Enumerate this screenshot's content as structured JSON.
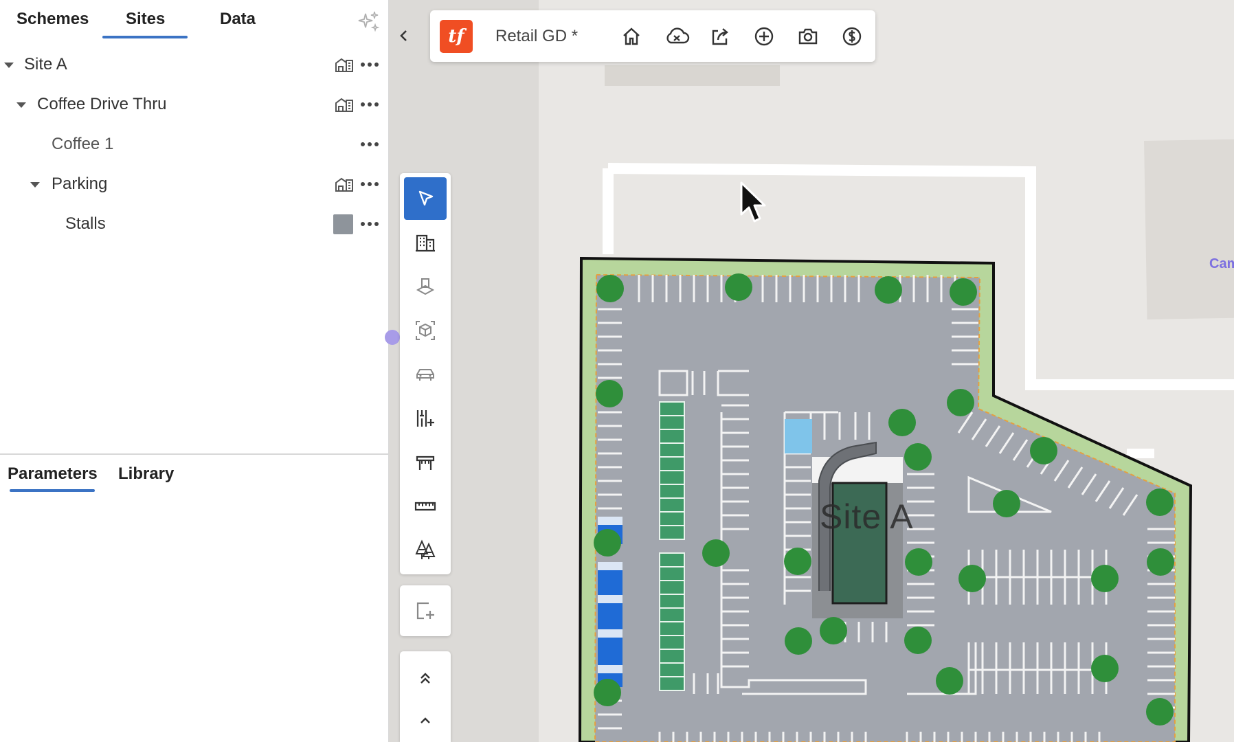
{
  "left_panel": {
    "tabs": [
      "Schemes",
      "Sites",
      "Data"
    ],
    "active_tab": "Sites",
    "tree": [
      {
        "label": "Site A",
        "level": 0,
        "expanded": true,
        "icon": "building-icon"
      },
      {
        "label": "Coffee Drive Thru",
        "level": 1,
        "expanded": true,
        "icon": "building-icon"
      },
      {
        "label": "Coffee 1",
        "level": 2,
        "icon": null
      },
      {
        "label": "Parking",
        "level": 2,
        "expanded": true,
        "icon": "building-icon"
      },
      {
        "label": "Stalls",
        "level": 3,
        "icon": "color-swatch"
      }
    ],
    "bottom_tabs": [
      "Parameters",
      "Library"
    ],
    "active_bottom_tab": "Parameters"
  },
  "toolbar": {
    "logo_text": "tf",
    "doc_title": "Retail GD *",
    "icons": [
      "home-icon",
      "cloud-sync-icon",
      "share-icon",
      "add-circle-icon",
      "camera-icon",
      "dollar-icon"
    ]
  },
  "palette": {
    "tools": [
      "select-arrow-icon",
      "building-icon",
      "podium-icon",
      "3d-box-icon",
      "car-icon",
      "stall-add-icon",
      "canopy-icon",
      "ruler-icon",
      "trees-icon"
    ],
    "active_tool": "select-arrow-icon"
  },
  "map": {
    "site_label": "Site A",
    "poi_label": "Cam",
    "colors": {
      "pavement": "#a2a6ae",
      "landscape": "#b7d69c",
      "tree": "#2f8f3a",
      "building": "#3c6a55",
      "ev_stall": "#3f9a68",
      "ada_stall": "#1f6bd6",
      "accent": "#2f6fca",
      "brand": "#f04e23"
    }
  }
}
